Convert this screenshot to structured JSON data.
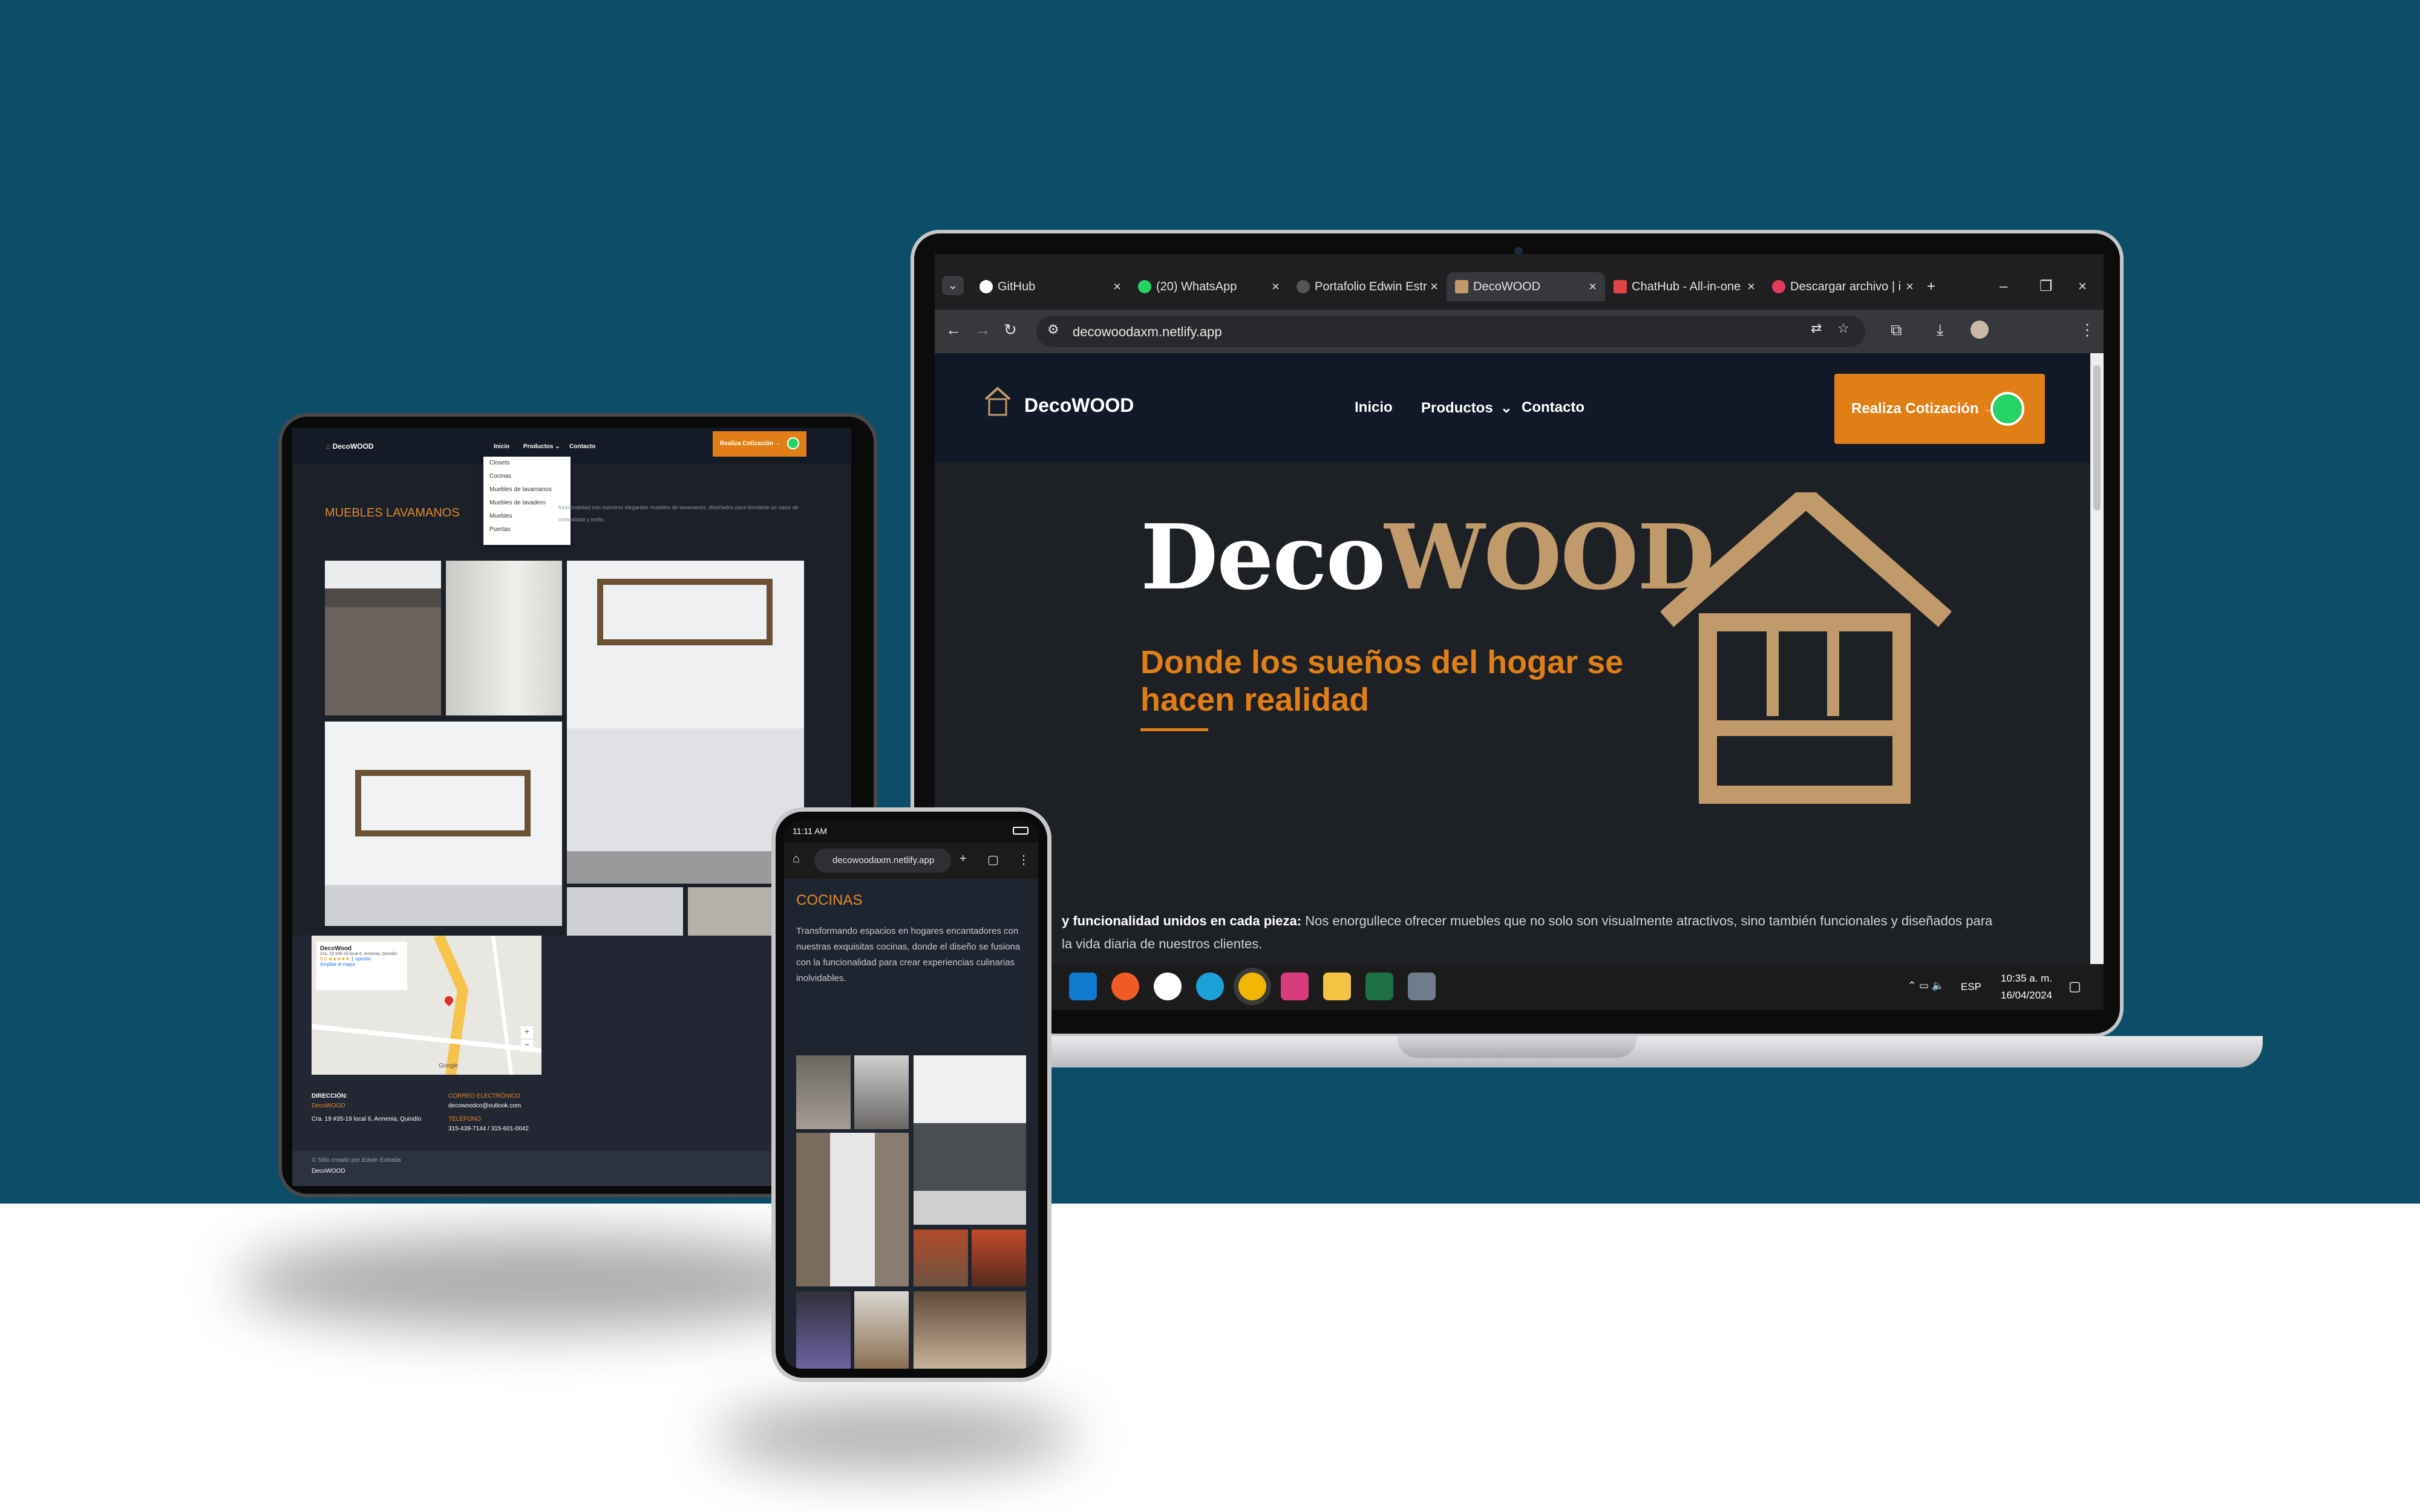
{
  "colors": {
    "backdrop": "#0d4d68",
    "accent": "#e07f16",
    "brand_tan": "#c19a6b",
    "site_bg": "#1d2025",
    "nav_bg": "#111827"
  },
  "laptop": {
    "tabs": [
      {
        "label": "GitHub",
        "icon": "github-icon"
      },
      {
        "label": "(20) WhatsApp",
        "icon": "whatsapp-icon"
      },
      {
        "label": "Portafolio Edwin Estr",
        "icon": "portfolio-icon"
      },
      {
        "label": "DecoWOOD",
        "icon": "house-icon"
      },
      {
        "label": "ChatHub - All-in-one",
        "icon": "chathub-icon"
      },
      {
        "label": "Descargar archivo | i",
        "icon": "heart-icon"
      }
    ],
    "url": "decowoodaxm.netlify.app",
    "site": {
      "brand": "DecoWOOD",
      "menu": {
        "inicio": "Inicio",
        "productos": "Productos",
        "contacto": "Contacto"
      },
      "cta": "Realiza Cotización",
      "hero_deco": "Deco",
      "hero_wood": "WOOD",
      "hero_subtitle": "Donde los sueños del hogar se hacen realidad",
      "about_bold": "y funcionalidad unidos en cada pieza:",
      "about_text": " Nos enorgullece ofrecer muebles que no solo son visualmente atractivos, sino también funcionales y diseñados para",
      "about_text2": "la vida diaria de nuestros clientes."
    },
    "taskbar": {
      "lang": "ESP",
      "time": "10:35 a. m.",
      "date": "16/04/2024"
    }
  },
  "tablet": {
    "brand": "DecoWOOD",
    "menu": {
      "inicio": "Inicio",
      "productos": "Productos",
      "contacto": "Contacto"
    },
    "cta": "Realiza Cotización",
    "dropdown": [
      "Closets",
      "Cocinas",
      "Muebles de lavamanos",
      "Muebles de lavadero",
      "Muebles",
      "Puertas"
    ],
    "section_title": "MUEBLES LAVAMANOS",
    "section_desc": "funcionalidad con nuestros elegantes muebles de lavamanos, diseñados para brindarte un oasis de comodidad y estilo.",
    "map": {
      "place": "DecoWood",
      "address": "Cra. 19 #35-19 local 6, Armenia, Quindío",
      "rating": "5.0 ★★★★★",
      "reviews": "1 opinión",
      "enlarge": "Ampliar el mapa",
      "link_google": "Google"
    },
    "footer": {
      "address_label": "DIRECCIÓN:",
      "address_brand": "DecoWOOD",
      "address": "Cra. 19 #35-19 local 6, Armenia, Quindío",
      "email_label": "CORREO ELECTRÓNICO",
      "email": "decowoodco@outlook.com",
      "phone_label": "TELÉFONO",
      "phone": "315-439-7144 / 315-601-0042",
      "credit": "© Sitio creado por Edwin Estrada",
      "credit_brand": "DecoWOOD"
    }
  },
  "phone": {
    "time": "11:11 AM",
    "url": "decowoodaxm.netlify.app",
    "section_title": "COCINAS",
    "section_desc": "Transformando espacios en hogares encantadores con nuestras exquisitas cocinas, donde el diseño se fusiona con la funcionalidad para crear experiencias culinarias inolvidables."
  }
}
